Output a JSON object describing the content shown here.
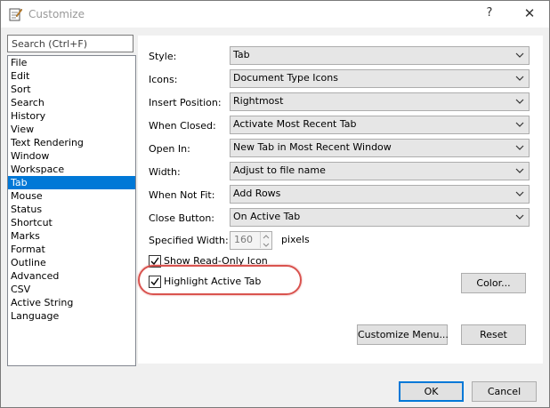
{
  "window": {
    "title": "Customize",
    "help_glyph": "?",
    "close_glyph": "✕"
  },
  "search": {
    "placeholder": "Search (Ctrl+F)"
  },
  "categories": [
    {
      "label": "File"
    },
    {
      "label": "Edit"
    },
    {
      "label": "Sort"
    },
    {
      "label": "Search"
    },
    {
      "label": "History"
    },
    {
      "label": "View"
    },
    {
      "label": "Text Rendering"
    },
    {
      "label": "Window"
    },
    {
      "label": "Workspace"
    },
    {
      "label": "Tab",
      "selected": true
    },
    {
      "label": "Mouse"
    },
    {
      "label": "Status"
    },
    {
      "label": "Shortcut"
    },
    {
      "label": "Marks"
    },
    {
      "label": "Format"
    },
    {
      "label": "Outline"
    },
    {
      "label": "Advanced"
    },
    {
      "label": "CSV"
    },
    {
      "label": "Active String"
    },
    {
      "label": "Language"
    }
  ],
  "settings": {
    "style": {
      "label": "Style:",
      "value": "Tab"
    },
    "icons": {
      "label": "Icons:",
      "value": "Document Type Icons"
    },
    "insert_position": {
      "label": "Insert Position:",
      "value": "Rightmost"
    },
    "when_closed": {
      "label": "When Closed:",
      "value": "Activate Most Recent Tab"
    },
    "open_in": {
      "label": "Open In:",
      "value": "New Tab in Most Recent Window"
    },
    "width": {
      "label": "Width:",
      "value": "Adjust to file name"
    },
    "when_not_fit": {
      "label": "When Not Fit:",
      "value": "Add Rows"
    },
    "close_button": {
      "label": "Close Button:",
      "value": "On Active Tab"
    },
    "specified_width": {
      "label": "Specified Width:",
      "value": "160",
      "unit": "pixels",
      "enabled": false
    },
    "show_read_only_icon": {
      "label": "Show Read-Only Icon",
      "checked": true
    },
    "highlight_active_tab": {
      "label": "Highlight Active Tab",
      "checked": true
    }
  },
  "buttons": {
    "color": "Color...",
    "customize_menu": "Customize Menu...",
    "reset": "Reset",
    "ok": "OK",
    "cancel": "Cancel"
  },
  "colors": {
    "selection": "#0078d7",
    "annotation_ring": "#d9534f"
  }
}
